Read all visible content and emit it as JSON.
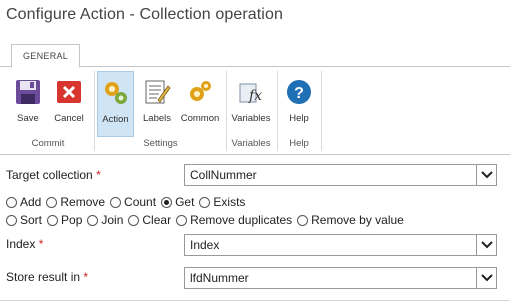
{
  "window": {
    "title": "Configure Action - Collection operation"
  },
  "tabs": [
    {
      "label": "GENERAL"
    }
  ],
  "ribbon": {
    "buttons": [
      {
        "label": "Save",
        "icon": "save-icon"
      },
      {
        "label": "Cancel",
        "icon": "cancel-icon"
      },
      {
        "label": "Action",
        "icon": "action-gears-icon"
      },
      {
        "label": "Labels",
        "icon": "labels-icon"
      },
      {
        "label": "Common",
        "icon": "common-gears-icon"
      },
      {
        "label": "Variables",
        "icon": "variables-fx-icon"
      },
      {
        "label": "Help",
        "icon": "help-icon"
      }
    ],
    "groups": [
      {
        "label": "Commit"
      },
      {
        "label": "Settings"
      },
      {
        "label": "Variables"
      },
      {
        "label": "Help"
      }
    ]
  },
  "form": {
    "target_collection": {
      "label": "Target collection",
      "required_mark": "*",
      "value": "CollNummer"
    },
    "operations_row1": [
      {
        "label": "Add",
        "selected": false
      },
      {
        "label": "Remove",
        "selected": false
      },
      {
        "label": "Count",
        "selected": false
      },
      {
        "label": "Get",
        "selected": true
      },
      {
        "label": "Exists",
        "selected": false
      }
    ],
    "operations_row2": [
      {
        "label": "Sort",
        "selected": false
      },
      {
        "label": "Pop",
        "selected": false
      },
      {
        "label": "Join",
        "selected": false
      },
      {
        "label": "Clear",
        "selected": false
      },
      {
        "label": "Remove duplicates",
        "selected": false
      },
      {
        "label": "Remove by value",
        "selected": false
      }
    ],
    "index": {
      "label": "Index",
      "required_mark": "*",
      "value": "Index"
    },
    "store_result": {
      "label": "Store result in",
      "required_mark": "*",
      "value": "lfdNummer"
    }
  },
  "colors": {
    "active_button_bg": "#cfe4f5",
    "required": "#d21d1d",
    "help_blue": "#1f6fb5",
    "cancel_red": "#d9352f",
    "save_purple": "#6b4c9a"
  }
}
